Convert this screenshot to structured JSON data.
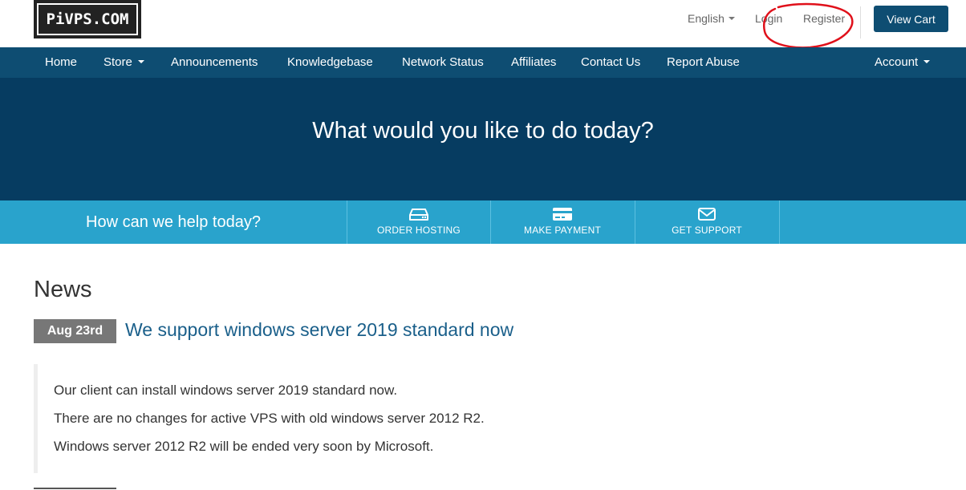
{
  "header": {
    "logo_text": "PiVPS.COM",
    "language": "English",
    "login": "Login",
    "register": "Register",
    "view_cart": "View Cart"
  },
  "nav": {
    "items": [
      {
        "label": "Home"
      },
      {
        "label": "Store"
      },
      {
        "label": "Announcements"
      },
      {
        "label": "Knowledgebase"
      },
      {
        "label": "Network Status"
      },
      {
        "label": "Affiliates"
      },
      {
        "label": "Contact Us"
      },
      {
        "label": "Report Abuse"
      }
    ],
    "account": "Account"
  },
  "hero": {
    "title": "What would you like to do today?"
  },
  "helpbar": {
    "prompt": "How can we help today?",
    "buttons": [
      {
        "label": "ORDER HOSTING",
        "icon": "hdd-icon"
      },
      {
        "label": "MAKE PAYMENT",
        "icon": "credit-card-icon"
      },
      {
        "label": "GET SUPPORT",
        "icon": "envelope-icon"
      }
    ]
  },
  "news": {
    "title": "News",
    "date": "Aug 23rd",
    "headline": "We support windows server 2019 standard now",
    "lines": [
      "Our client can install windows server 2019 standard now.",
      "There are no changes for active VPS with old windows server 2012 R2.",
      "Windows server 2012 R2 will be ended very soon by Microsoft."
    ]
  },
  "colors": {
    "nav_bg": "#0e4d72",
    "hero_bg": "#063c61",
    "helpbar_bg": "#29a3cc",
    "link": "#1a5f8a",
    "badge_bg": "#777777",
    "annotation": "#e0101a"
  }
}
